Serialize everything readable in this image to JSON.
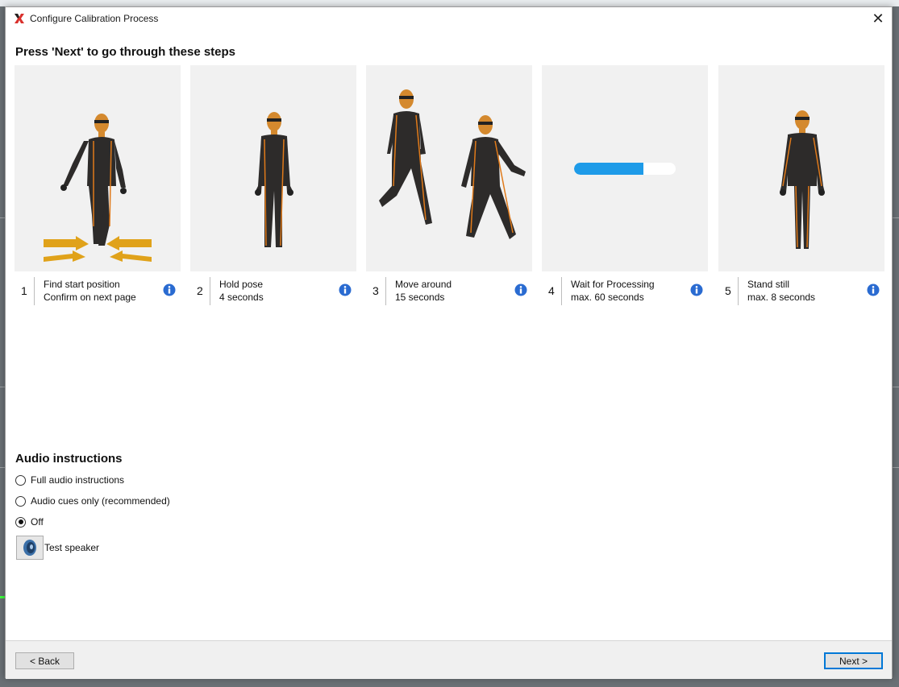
{
  "window": {
    "title": "Configure Calibration Process",
    "close_symbol": "✕",
    "icon": "xsens-x-logo"
  },
  "steps_section": {
    "heading": "Press 'Next' to go through these steps",
    "steps": [
      {
        "number": "1",
        "title": "Find start position",
        "subtitle": "Confirm on next page",
        "image": "figure-start-position-with-arrows",
        "info_icon": "info-icon"
      },
      {
        "number": "2",
        "title": "Hold pose",
        "subtitle": "4 seconds",
        "image": "figure-standing-pose",
        "info_icon": "info-icon"
      },
      {
        "number": "3",
        "title": "Move around",
        "subtitle": "15 seconds",
        "image": "figures-walking",
        "info_icon": "info-icon"
      },
      {
        "number": "4",
        "title": "Wait for Processing",
        "subtitle": "max. 60 seconds",
        "image": "progress-bar",
        "progress": 0.68,
        "info_icon": "info-icon"
      },
      {
        "number": "5",
        "title": "Stand still",
        "subtitle": "max. 8 seconds",
        "image": "figure-standing-front",
        "info_icon": "info-icon"
      }
    ]
  },
  "audio": {
    "heading": "Audio instructions",
    "options": [
      {
        "label": "Full audio instructions",
        "checked": false
      },
      {
        "label": "Audio cues only (recommended)",
        "checked": false
      },
      {
        "label": "Off",
        "checked": true
      }
    ],
    "test_speaker_label": "Test speaker",
    "test_speaker_icon": "speaker-icon"
  },
  "footer": {
    "back_label": "< Back",
    "next_label": "Next >"
  },
  "colors": {
    "accent": "#0078d7",
    "suit": "#2d2b2a",
    "suit_stripe": "#e07a1a",
    "skin": "#d4892e",
    "arrow": "#e0a21a",
    "progress_fill": "#1e9be8",
    "info_blue": "#2a6bd1",
    "logo_red": "#d9302c"
  }
}
